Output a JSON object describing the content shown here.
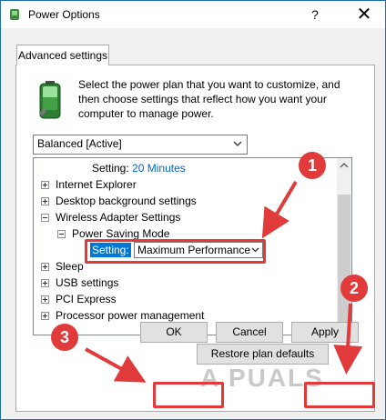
{
  "window": {
    "title": "Power Options",
    "help_glyph": "?",
    "close_glyph": "✕"
  },
  "tab": {
    "label": "Advanced settings"
  },
  "description": "Select the power plan that you want to customize, and then choose settings that reflect how you want your computer to manage power.",
  "plan_select": {
    "value": "Balanced [Active]"
  },
  "tree": {
    "top_setting_label": "Setting:",
    "top_setting_value": "20 Minutes",
    "items": [
      {
        "label": "Internet Explorer",
        "expander": "+"
      },
      {
        "label": "Desktop background settings",
        "expander": "+"
      },
      {
        "label": "Wireless Adapter Settings",
        "expander": "-"
      },
      {
        "label": "Power Saving Mode",
        "expander": "-"
      },
      {
        "label": "Sleep",
        "expander": "+"
      },
      {
        "label": "USB settings",
        "expander": "+"
      },
      {
        "label": "PCI Express",
        "expander": "+"
      },
      {
        "label": "Processor power management",
        "expander": "+"
      }
    ],
    "inline_setting": {
      "label": "Setting:",
      "value": "Maximum Performance"
    }
  },
  "buttons": {
    "restore": "Restore plan defaults",
    "ok": "OK",
    "cancel": "Cancel",
    "apply": "Apply"
  },
  "annotations": {
    "badges": [
      "1",
      "2",
      "3"
    ],
    "color": "#e03a3a"
  },
  "watermark": {
    "text": "A  PUALS"
  },
  "colors": {
    "accent": "#0078d7",
    "link_blue": "#0066cc",
    "window_border": "#1e6ea8"
  }
}
